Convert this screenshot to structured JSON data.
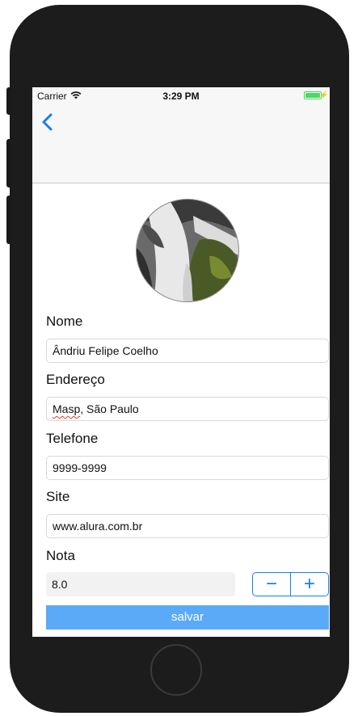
{
  "status_bar": {
    "carrier": "Carrier",
    "time": "3:29 PM",
    "battery_color": "#4cd964",
    "icons": [
      "wifi-icon",
      "battery-icon",
      "charging-bolt-icon"
    ]
  },
  "nav": {
    "back_icon": "chevron-left-icon",
    "accent_color": "#1a7cf2"
  },
  "form": {
    "nome": {
      "label": "Nome",
      "value": "Ândriu Felipe Coelho"
    },
    "endereco": {
      "label": "Endereço",
      "value_misspelled": "Masp",
      "value_rest": ", São Paulo"
    },
    "telefone": {
      "label": "Telefone",
      "value": "9999-9999"
    },
    "site": {
      "label": "Site",
      "value": "www.alura.com.br"
    },
    "nota": {
      "label": "Nota",
      "value": "8.0",
      "minus": "−",
      "plus": "+"
    }
  },
  "save_button": {
    "label": "salvar",
    "color": "#5aaaf8"
  }
}
